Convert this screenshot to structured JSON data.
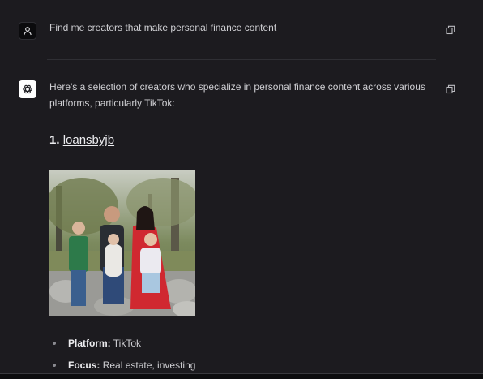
{
  "user_message": {
    "text": "Find me creators that make personal finance content"
  },
  "assistant_message": {
    "intro": "Here's a selection of creators who specialize in personal finance content across various platforms, particularly TikTok:",
    "creators": [
      {
        "number": "1.",
        "handle": "loansbyjb",
        "photo_icon": "family-photo",
        "details": [
          {
            "key": "Platform:",
            "value": "TikTok"
          },
          {
            "key": "Focus:",
            "value": "Real estate, investing"
          }
        ]
      }
    ]
  },
  "icons": {
    "user_avatar": "user-icon",
    "bot_avatar": "openai-logo-icon",
    "copy": "copy-icon"
  },
  "colors": {
    "background": "#1c1b1f",
    "text": "#cfcfd3",
    "heading": "#ececef",
    "divider": "#2f2f34"
  }
}
